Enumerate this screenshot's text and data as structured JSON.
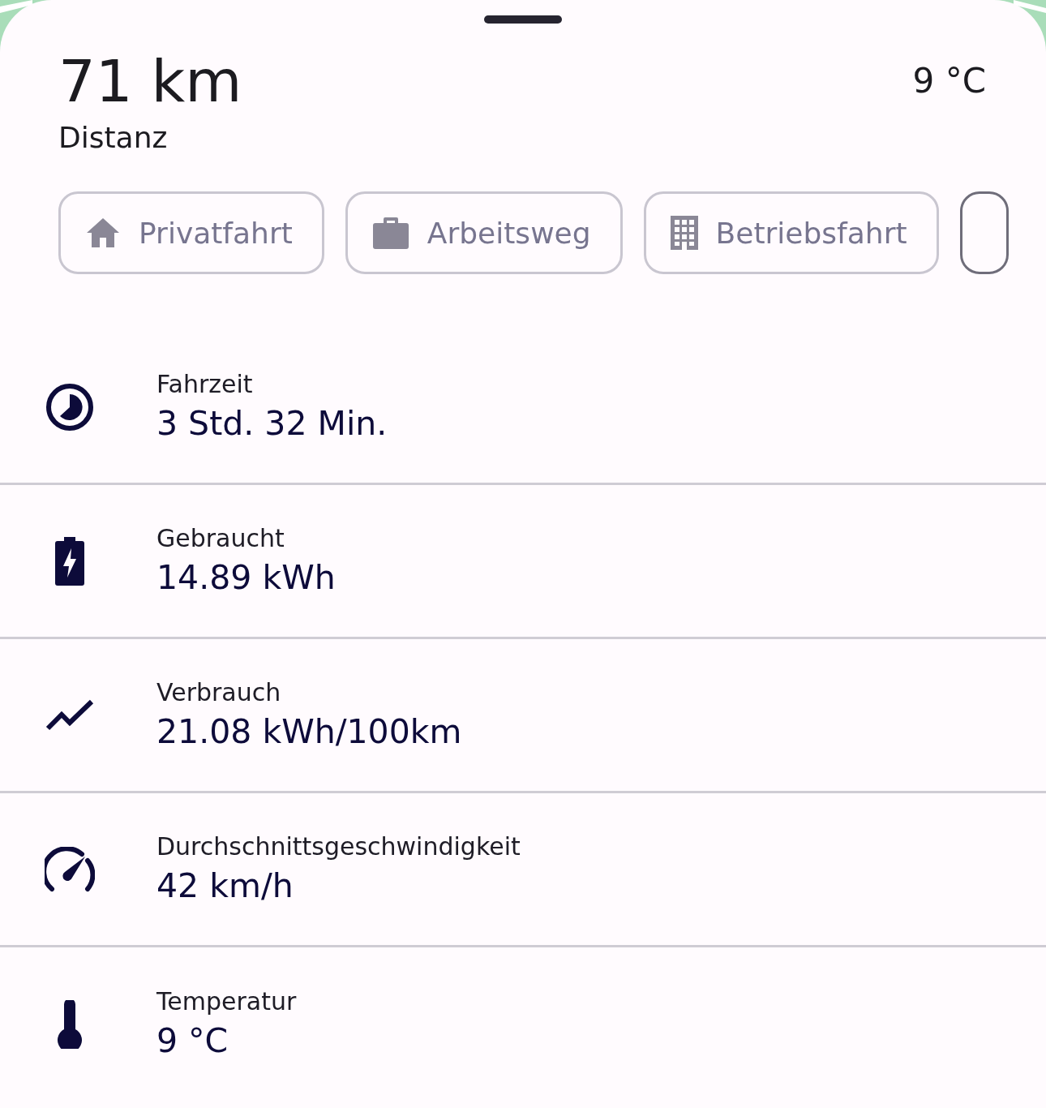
{
  "summary": {
    "distance": "71 km",
    "distance_label": "Distanz",
    "temperature": "9 °C"
  },
  "chips": [
    {
      "label": "Privatfahrt"
    },
    {
      "label": "Arbeitsweg"
    },
    {
      "label": "Betriebsfahrt"
    }
  ],
  "stats": [
    {
      "label": "Fahrzeit",
      "value": "3 Std. 32 Min."
    },
    {
      "label": "Gebraucht",
      "value": "14.89 kWh"
    },
    {
      "label": "Verbrauch",
      "value": "21.08 kWh/100km"
    },
    {
      "label": "Durchschnittsgeschwindigkeit",
      "value": "42 km/h"
    },
    {
      "label": "Temperatur",
      "value": "9 °C"
    }
  ]
}
